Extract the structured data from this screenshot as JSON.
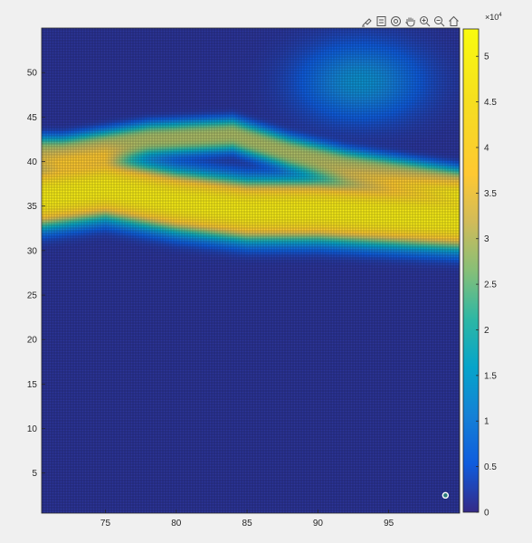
{
  "toolbar": {
    "icons": [
      "brush-data-icon",
      "data-tips-icon",
      "rotate-3d-icon",
      "pan-icon",
      "zoom-in-icon",
      "zoom-out-icon",
      "home-icon"
    ]
  },
  "chart_data": {
    "type": "heatmap",
    "title": "",
    "xlabel": "",
    "ylabel": "",
    "xlim": [
      70.5,
      100
    ],
    "ylim": [
      0.5,
      55
    ],
    "x_ticks": [
      75,
      80,
      85,
      90,
      95
    ],
    "y_ticks": [
      5,
      10,
      15,
      20,
      25,
      30,
      35,
      40,
      45,
      50
    ],
    "x_tick_labels": [
      "75",
      "80",
      "85",
      "90",
      "95"
    ],
    "y_tick_labels": [
      "5",
      "10",
      "15",
      "20",
      "25",
      "30",
      "35",
      "40",
      "45",
      "50"
    ],
    "grid": false,
    "colormap": "parula",
    "colors": {
      "low": "#352a87",
      "mid": "#21a5b5",
      "high": "#f9fb0e",
      "background": "#f0f0f0"
    },
    "colorbar": {
      "clim": [
        0,
        53000
      ],
      "ticks": [
        0,
        5000,
        10000,
        15000,
        20000,
        25000,
        30000,
        35000,
        40000,
        45000,
        50000
      ],
      "tick_labels": [
        "0",
        "0.5",
        "1",
        "1.5",
        "2",
        "2.5",
        "3",
        "3.5",
        "4",
        "4.5",
        "5"
      ],
      "exponent_base": "×10",
      "exponent_power": "4"
    },
    "features": [
      {
        "description": "high band",
        "y_center_at_x": [
          [
            70.5,
            36
          ],
          [
            75,
            37
          ],
          [
            80,
            35.5
          ],
          [
            85,
            34.5
          ],
          [
            90,
            34.5
          ],
          [
            95,
            34
          ],
          [
            100,
            33.5
          ]
        ],
        "half_width": 3,
        "peak": 48000
      },
      {
        "description": "upper arc",
        "y_center_at_x": [
          [
            72,
            41
          ],
          [
            78,
            42.5
          ],
          [
            84,
            43
          ],
          [
            88,
            41
          ],
          [
            92,
            39.5
          ],
          [
            96,
            38.5
          ],
          [
            100,
            37.5
          ]
        ],
        "half_width": 1.6,
        "peak": 28000
      },
      {
        "description": "upper right glow",
        "center": [
          93,
          49
        ],
        "spread": [
          4,
          4
        ],
        "peak": 12000
      }
    ],
    "marker": {
      "x": 99,
      "y": 2.5
    }
  }
}
